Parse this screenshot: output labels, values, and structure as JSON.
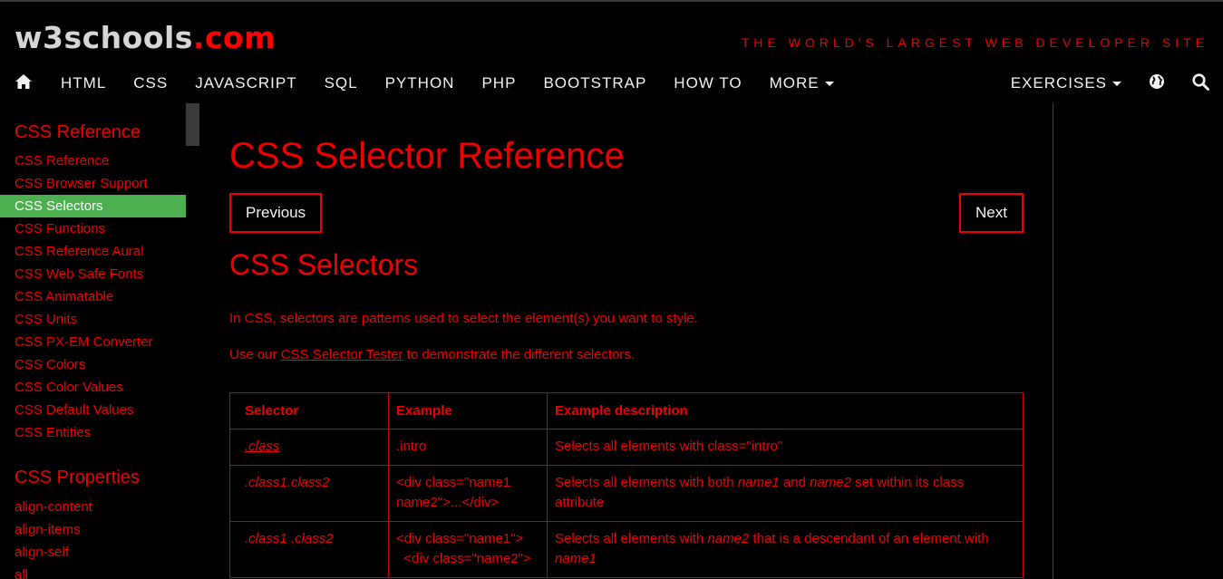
{
  "header": {
    "logo_w3": "w3schools",
    "logo_com": ".com",
    "tagline": "THE WORLD'S LARGEST WEB DEVELOPER SITE"
  },
  "topnav": {
    "items": [
      "HTML",
      "CSS",
      "JAVASCRIPT",
      "SQL",
      "PYTHON",
      "PHP",
      "BOOTSTRAP",
      "HOW TO",
      "MORE"
    ],
    "exercises": "EXERCISES",
    "icons": [
      "home-icon",
      "globe-icon",
      "search-icon"
    ]
  },
  "sidebar": {
    "heading_reference": "CSS Reference",
    "reference_links": [
      "CSS Reference",
      "CSS Browser Support",
      "CSS Selectors",
      "CSS Functions",
      "CSS Reference Aural",
      "CSS Web Safe Fonts",
      "CSS Animatable",
      "CSS Units",
      "CSS PX-EM Converter",
      "CSS Colors",
      "CSS Color Values",
      "CSS Default Values",
      "CSS Entities"
    ],
    "active_link": "CSS Selectors",
    "heading_properties": "CSS Properties",
    "property_links": [
      "align-content",
      "align-items",
      "align-self",
      "all"
    ]
  },
  "main": {
    "title": "CSS Selector Reference",
    "prev_label": " Previous",
    "next_label": "Next ",
    "section_title": "CSS Selectors",
    "intro": "In CSS, selectors are patterns used to select the element(s) you want to style.",
    "tester_prefix": "Use our ",
    "tester_link": "CSS Selector Tester",
    "tester_suffix": " to demonstrate the different selectors.",
    "table": {
      "headers": [
        "Selector",
        "Example",
        "Example description"
      ],
      "rows": [
        {
          "selector": ".class",
          "example": ".intro",
          "description": "Selects all elements with class=\"intro\""
        },
        {
          "selector": ".class1.class2",
          "example": "<div class=\"name1 name2\">...</div>",
          "description": "Selects all elements with both name1 and name2 set within its class attribute"
        },
        {
          "selector": ".class1 .class2",
          "example": "<div class=\"name1\">\n  <div class=\"name2\">",
          "description": "Selects all elements with name2 that is a descendant of an element with name1"
        }
      ]
    }
  },
  "colors": {
    "accent": "#ee0000",
    "active_bg": "#4CAF50",
    "background": "#000000"
  }
}
